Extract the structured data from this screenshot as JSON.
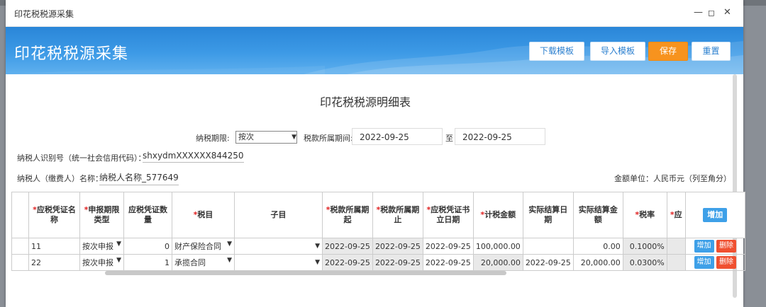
{
  "window": {
    "title": "印花税税源采集"
  },
  "banner": {
    "title": "印花税税源采集",
    "download_label": "下载模板",
    "import_label": "导入模板",
    "save_label": "保存",
    "reset_label": "重置"
  },
  "form": {
    "heading": "印花税税源明细表",
    "period_label": "纳税期限:",
    "period_value": "按次",
    "tax_period_label": "税款所属期间:",
    "start_date": "2022-09-25",
    "to_label": "至",
    "end_date": "2022-09-25",
    "taxpayer_id_label": "纳税人识别号（统一社会信用代码）：",
    "taxpayer_id_value": "shxydmXXXXXX844250",
    "taxpayer_name_label": "纳税人（缴费人）名称：",
    "taxpayer_name_value": "纳税人名称_577649",
    "currency_note": "金额单位：人民币元（列至角分）"
  },
  "table": {
    "headers": {
      "voucher_name": "应税凭证名称",
      "period_type": "申报期限类型",
      "count": "应税凭证数量",
      "item": "税目",
      "subitem": "子目",
      "period_start": "税款所属期起",
      "period_end": "税款所属期止",
      "doc_date": "应税凭证书立日期",
      "taxable_amount": "计税金额",
      "settle_date": "实际结算日期",
      "settle_amount": "实际结算金额",
      "rate": "税率",
      "extra": "应",
      "add_label": "增加"
    },
    "rows": [
      {
        "voucher_name": "11",
        "period_type": "按次申报",
        "count": "0",
        "item": "财产保险合同",
        "subitem": "",
        "period_start": "2022-09-25",
        "period_end": "2022-09-25",
        "doc_date": "2022-09-25",
        "taxable_amount": "100,000.00",
        "settle_date": "",
        "settle_amount": "0.00",
        "rate": "0.1000%",
        "add": "增加",
        "del": "删除"
      },
      {
        "voucher_name": "22",
        "period_type": "按次申报",
        "count": "1",
        "item": "承揽合同",
        "subitem": "",
        "period_start": "2022-09-25",
        "period_end": "2022-09-25",
        "doc_date": "2022-09-25",
        "taxable_amount": "20,000.00",
        "settle_date": "2022-09-25",
        "settle_amount": "20,000.00",
        "rate": "0.0300%",
        "add": "增加",
        "del": "删除"
      }
    ]
  }
}
